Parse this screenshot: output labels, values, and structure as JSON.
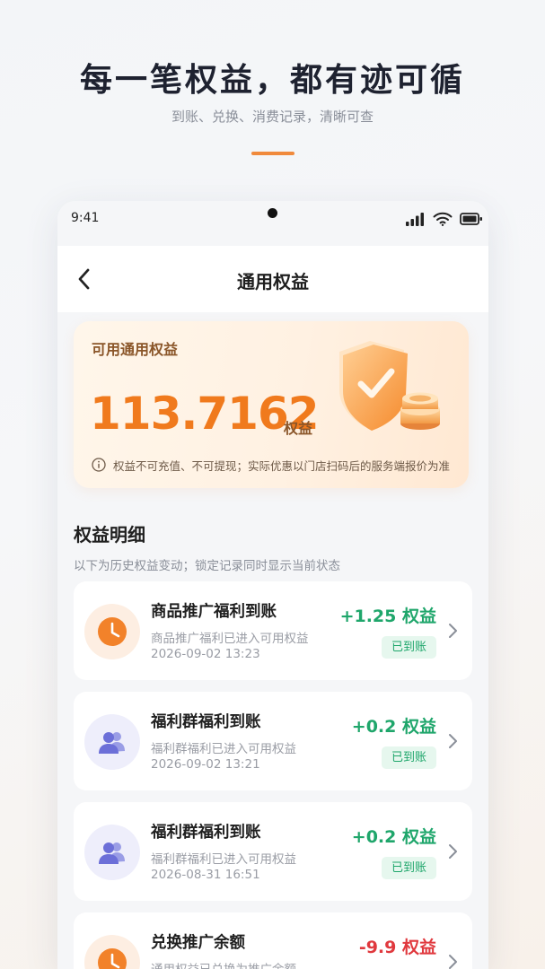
{
  "hero": {
    "title": "每一笔权益，都有迹可循",
    "subtitle": "到账、兑换、消费记录，清晰可查"
  },
  "status_bar": {
    "time": "9:41",
    "icons": [
      "signal-icon",
      "wifi-icon",
      "battery-icon"
    ]
  },
  "nav": {
    "title": "通用权益",
    "back_icon": "chevron-left-icon"
  },
  "balance": {
    "label": "可用通用权益",
    "value": "113.7162",
    "unit": "权益",
    "note": "权益不可充值、不可提现；实际优惠以门店扫码后的服务端报价为准",
    "illustration": "shield-check-coins-icon"
  },
  "details": {
    "title": "权益明细",
    "subtitle": "以下为历史权益变动；锁定记录同时显示当前状态",
    "records": [
      {
        "icon": "clock-icon",
        "icon_color": "#f2822a",
        "title": "商品推广福利到账",
        "desc": "商品推广福利已进入可用权益",
        "time": "2026-09-02 13:23",
        "amount": "+1.25 权益",
        "status": "已到账"
      },
      {
        "icon": "users-icon",
        "icon_color": "#6c6fd8",
        "title": "福利群福利到账",
        "desc": "福利群福利已进入可用权益",
        "time": "2026-09-02 13:21",
        "amount": "+0.2 权益",
        "status": "已到账"
      },
      {
        "icon": "users-icon",
        "icon_color": "#6c6fd8",
        "title": "福利群福利到账",
        "desc": "福利群福利已进入可用权益",
        "time": "2026-08-31 16:51",
        "amount": "+0.2 权益",
        "status": "已到账"
      },
      {
        "icon": "clock-icon",
        "icon_color": "#f2822a",
        "title": "兑换推广余额",
        "desc": "通用权益已兑换为推广余额",
        "amount": "-9.9 权益"
      }
    ]
  },
  "colors": {
    "accent_orange": "#f07a1d",
    "positive_green": "#1fa66b",
    "negative_red": "#e0393e"
  }
}
